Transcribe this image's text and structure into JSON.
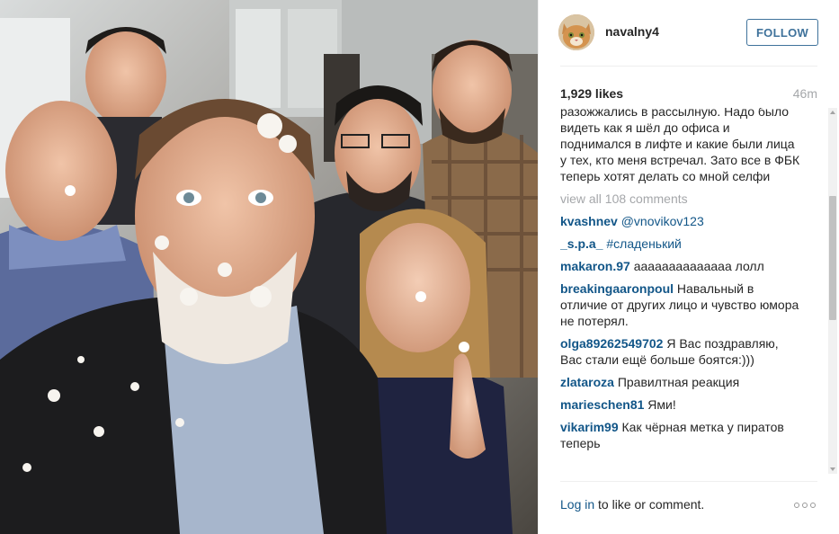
{
  "post": {
    "username": "navalny4",
    "follow_label": "FOLLOW",
    "likes": "1,929 likes",
    "time": "46m",
    "caption": "разожжались в рассылную. Надо было видеть как я шёл до офиса и поднимался в лифте и какие были лица у тех, кто меня встречал. Зато все в ФБК теперь хотят делать со мной селфи",
    "view_all": "view all 108 comments",
    "login_link": "Log in",
    "login_rest": " to like or comment."
  },
  "comments": [
    {
      "user": "kvashnev",
      "text": "@vnovikov123",
      "mention": true
    },
    {
      "user": "_s.p.a_",
      "text": "#сладенький",
      "mention": true
    },
    {
      "user": "makaron.97",
      "text": "аааааааааааааа лолл",
      "mention": false
    },
    {
      "user": "breakingaaronpoul",
      "text": "Навальный в отличие от других лицо и чувство юмора не потерял.",
      "mention": false
    },
    {
      "user": "olga89262549702",
      "text": "Я Вас поздравляю, Вас стали ещё больше боятся:)))",
      "mention": false
    },
    {
      "user": "zlataroza",
      "text": "Правилтная реакция",
      "mention": false
    },
    {
      "user": "marieschen81",
      "text": "Ями!",
      "mention": false
    },
    {
      "user": "vikarim99",
      "text": "Как чёрная метка у пиратов теперь",
      "mention": false
    }
  ],
  "colors": {
    "link": "#125688",
    "follow": "#3f729b",
    "muted": "#a5a7aa"
  },
  "icons": {
    "more": "more-options-icon",
    "avatar": "cat-avatar"
  }
}
